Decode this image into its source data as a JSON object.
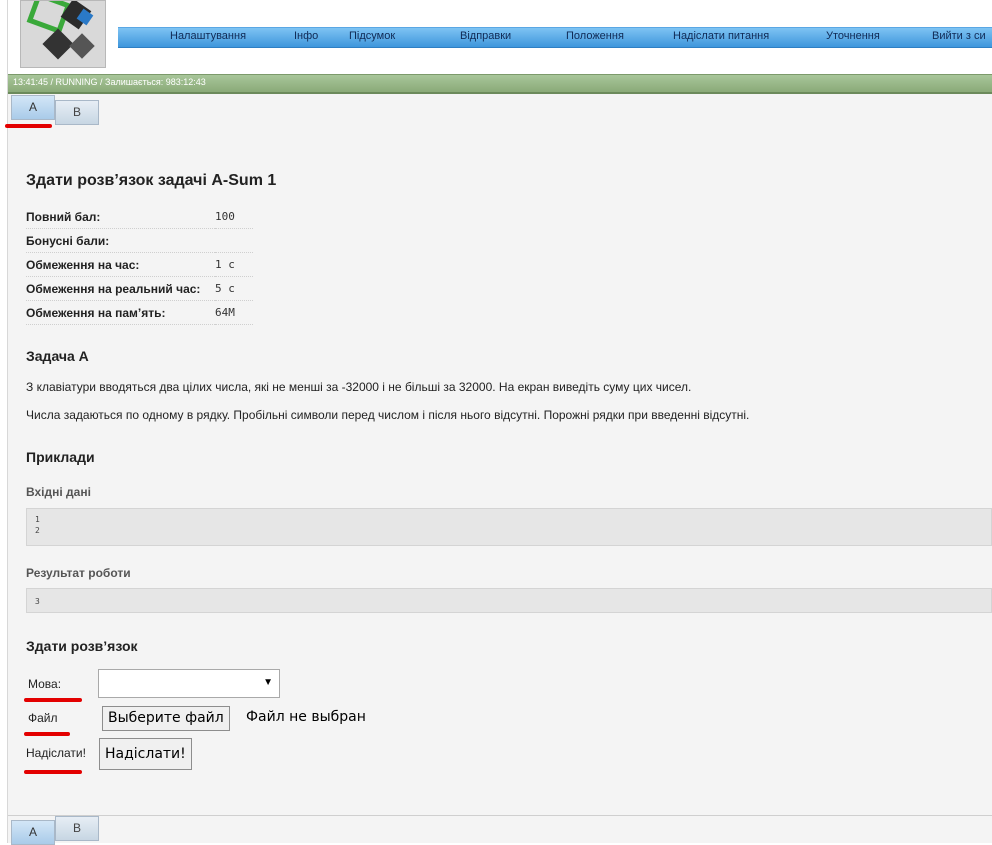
{
  "header": {
    "menu": [
      "Налаштування",
      "Інфо",
      "Підсумок",
      "Відправки",
      "Положення",
      "Надіслати питання",
      "Уточнення",
      "Вийти з си"
    ]
  },
  "status": {
    "text": "13:41:45 / RUNNING / Залишається: 983:12:43"
  },
  "tabs": [
    "A",
    "B"
  ],
  "problem": {
    "title": "Здати розв’язок задачі A-Sum 1",
    "limits": [
      {
        "label": "Повний бал:",
        "value": "100"
      },
      {
        "label": "Бонусні бали:",
        "value": ""
      },
      {
        "label": "Обмеження на час:",
        "value": "1 с"
      },
      {
        "label": "Обмеження на реальний час:",
        "value": "5 с"
      },
      {
        "label": "Обмеження на пам’ять:",
        "value": "64M"
      }
    ],
    "heading": "Задача A",
    "statement": [
      "З клавіатури вводяться два цілих числа, які не менші за -32000 і не більші за 32000. На екран виведіть суму цих чисел.",
      "Числа задаються по одному в рядку. Пробільні символи перед числом і після нього відсутні. Порожні рядки при введенні відсутні."
    ]
  },
  "examples": {
    "heading": "Приклади",
    "input_label": "Вхідні дані",
    "input_lines": [
      "1",
      "2"
    ],
    "output_label": "Результат роботи",
    "output_lines": [
      "3"
    ]
  },
  "submit": {
    "heading": "Здати розв’язок",
    "language_label": "Мова:",
    "language_value": "",
    "file_label": "Файл",
    "file_button": "Выберите файл",
    "file_status": "Файл не выбран",
    "send_label": "Надіслати!",
    "send_button": "Надіслати!"
  },
  "colors": {
    "menubar": "#4aa1e2",
    "statusbar": "#97b686",
    "annotation": "#e30000"
  }
}
